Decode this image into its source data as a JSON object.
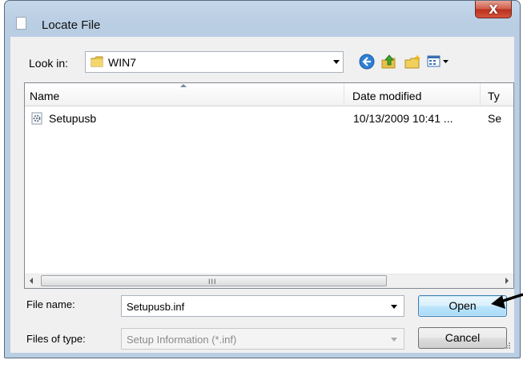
{
  "dialog": {
    "title": "Locate File"
  },
  "toolbar": {
    "look_in_label": "Look in:",
    "look_in_value": "WIN7",
    "icons": [
      "back-icon",
      "up-folder-icon",
      "new-folder-icon",
      "view-menu-icon"
    ]
  },
  "file_list": {
    "columns": [
      "Name",
      "Date modified",
      "Ty"
    ],
    "rows": [
      {
        "name": "Setupusb",
        "date": "10/13/2009 10:41 ...",
        "type": "Se",
        "icon": "setup-file-icon"
      }
    ],
    "scrollbar_grip": "III"
  },
  "form": {
    "file_name_label": "File name:",
    "file_name_value": "Setupusb.inf",
    "file_type_label": "Files of type:",
    "file_type_value": "Setup Information (*.inf)"
  },
  "buttons": {
    "open": "Open",
    "cancel": "Cancel",
    "close": "X"
  },
  "colors": {
    "close_button": "#c74a37",
    "open_button_border": "#3c7fb1",
    "frame": "#b9cde3"
  }
}
